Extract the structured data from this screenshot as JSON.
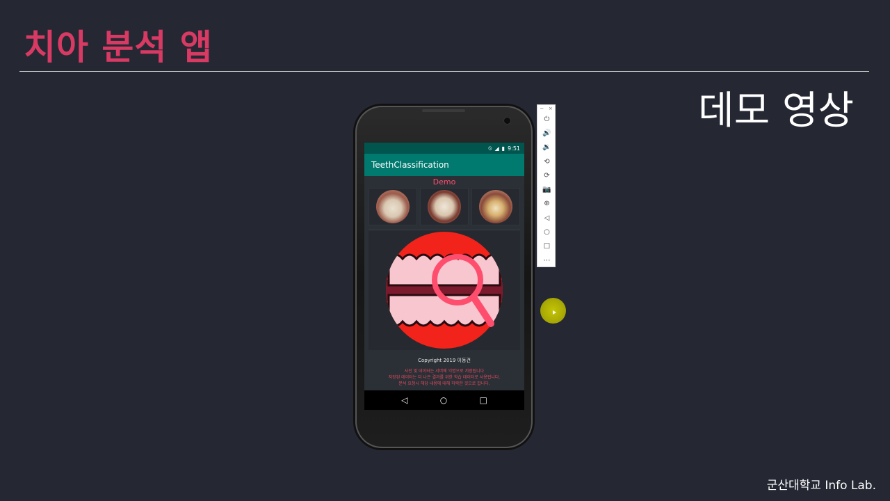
{
  "slide": {
    "title": "치아 분석 앱",
    "subtitle": "데모 영상",
    "credit": "군산대학교 Info Lab."
  },
  "phone": {
    "status_bar": {
      "time": "9:51",
      "icons": [
        "no-disturb-icon",
        "signal-icon",
        "battery-icon"
      ]
    },
    "app_bar": {
      "title": "TeethClassification"
    },
    "demo_label": "Demo",
    "thumbnails": [
      {
        "name": "teeth-photo-1"
      },
      {
        "name": "teeth-photo-2"
      },
      {
        "name": "teeth-photo-3"
      }
    ],
    "copyright": "Copyright 2019 이동건",
    "notice": [
      "사진 및 데이터는 서버에 익명으로 저장됩니다",
      "저장된 데이터는 더 나은 결과를 위한 학습 데이터로 사용됩니다.",
      "분석 요청시 해당 내용에 대해 허락한 것으로 합니다."
    ],
    "nav": {
      "back": "◁",
      "home": "○",
      "recents": "□"
    },
    "colors": {
      "status_bar": "#00564f",
      "app_bar": "#00796f",
      "accent": "#ff4d6d",
      "logo_red": "#f2231a"
    }
  },
  "emulator_toolbar": {
    "window_controls": [
      "−",
      "×"
    ],
    "buttons": [
      {
        "name": "power-icon",
        "glyph": "⏻"
      },
      {
        "name": "volume-up-icon",
        "glyph": "🔊"
      },
      {
        "name": "volume-down-icon",
        "glyph": "🔉"
      },
      {
        "name": "rotate-left-icon",
        "glyph": "⟲"
      },
      {
        "name": "rotate-right-icon",
        "glyph": "⟳"
      },
      {
        "name": "screenshot-icon",
        "glyph": "📷"
      },
      {
        "name": "zoom-icon",
        "glyph": "⊕"
      },
      {
        "name": "back-icon",
        "glyph": "◁"
      },
      {
        "name": "home-icon",
        "glyph": "○"
      },
      {
        "name": "overview-icon",
        "glyph": "□"
      },
      {
        "name": "more-icon",
        "glyph": "⋯"
      }
    ]
  }
}
